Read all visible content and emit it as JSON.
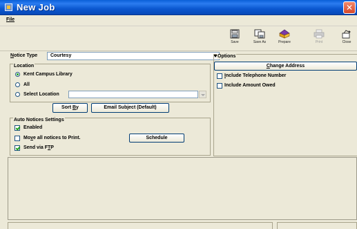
{
  "window": {
    "title": "New Job",
    "close_glyph": "✕"
  },
  "menu": {
    "file": "File"
  },
  "toolbar": {
    "buttons": [
      {
        "label": "Save",
        "icon": "save-icon",
        "enabled": true
      },
      {
        "label": "Save As",
        "icon": "save-as-icon",
        "enabled": true
      },
      {
        "label": "Prepare",
        "icon": "prepare-icon",
        "enabled": true
      },
      {
        "label": "Print",
        "icon": "print-icon",
        "enabled": false
      },
      {
        "label": "Close",
        "icon": "close-icon",
        "enabled": true
      }
    ]
  },
  "notice": {
    "label": "Notice Type",
    "value": "Courtesy"
  },
  "location": {
    "title": "Location",
    "options": [
      {
        "label": "Kent Campus Library",
        "selected": true
      },
      {
        "label": "All",
        "selected": false
      },
      {
        "label": "Select Location",
        "selected": false
      }
    ],
    "select_value": ""
  },
  "buttons": {
    "sort_by": "Sort By",
    "email_subject": "Email Subject (Default)",
    "schedule": "Schedule",
    "change_address": "Change Address"
  },
  "auto": {
    "title": "Auto Notices Settings",
    "enabled": {
      "label": "Enabled",
      "checked": true
    },
    "move_all": {
      "label": "Move all notices to Print.",
      "checked": false
    },
    "ftp": {
      "label": "Send via FTP",
      "checked": true
    }
  },
  "options": {
    "title": "Options",
    "include_phone": {
      "label": "Include Telephone Number",
      "checked": false
    },
    "include_amount": {
      "label": "Include Amount Owed",
      "checked": false
    }
  },
  "colors": {
    "title_bar": "#0b58d0",
    "close_button": "#d6482a",
    "check_mark": "#21a121",
    "field_border": "#7f9db9"
  }
}
